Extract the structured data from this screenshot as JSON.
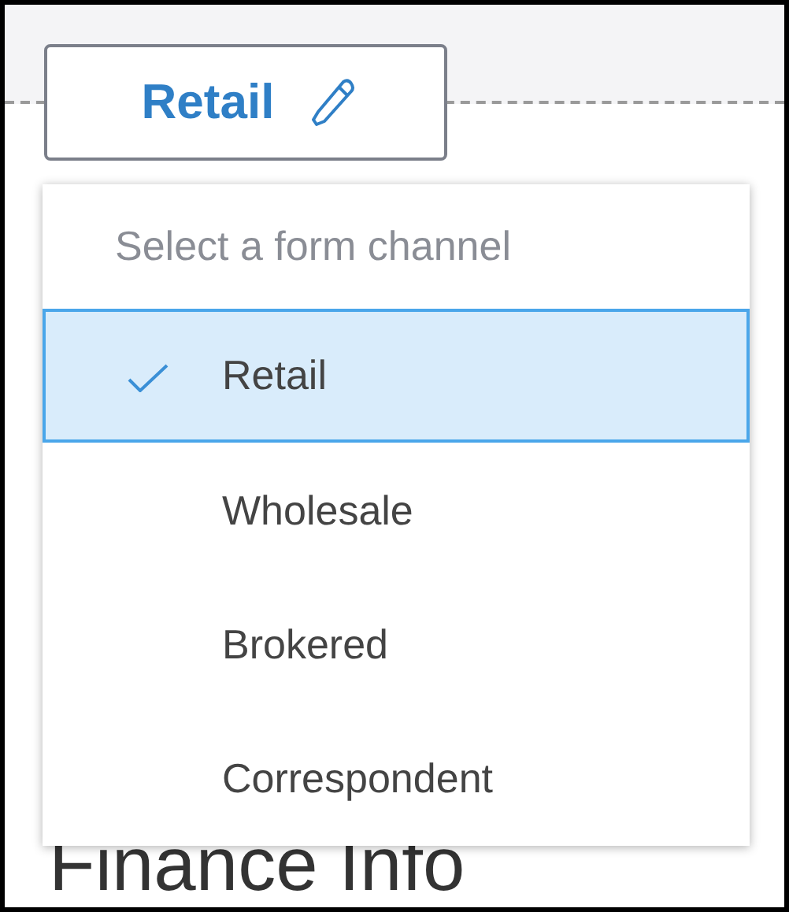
{
  "channel_button": {
    "label": "Retail"
  },
  "dropdown": {
    "header": "Select a form channel",
    "options": [
      {
        "label": "Retail",
        "selected": true
      },
      {
        "label": "Wholesale",
        "selected": false
      },
      {
        "label": "Brokered",
        "selected": false
      },
      {
        "label": "Correspondent",
        "selected": false
      }
    ]
  },
  "section_heading": "Finance Info"
}
